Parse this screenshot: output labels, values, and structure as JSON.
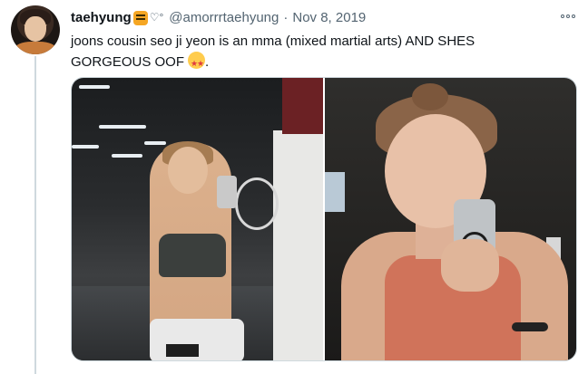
{
  "tweet": {
    "display_name": "taehyung",
    "name_deco": "♡°",
    "handle": "@amorrrtaehyung",
    "separator": "·",
    "date": "Nov 8, 2019",
    "text_line1": "joons cousin seo ji yeon is an mma (mixed martial arts) AND SHES",
    "text_line2": "GORGEOUS OOF",
    "text_end": "."
  },
  "icons": {
    "more": "more-horizontal-icon",
    "name_emoji": "tiger-face-emoji",
    "text_emoji": "star-struck-emoji"
  },
  "colors": {
    "text": "#0f1419",
    "secondary": "#536471",
    "border": "#cfd9de"
  }
}
